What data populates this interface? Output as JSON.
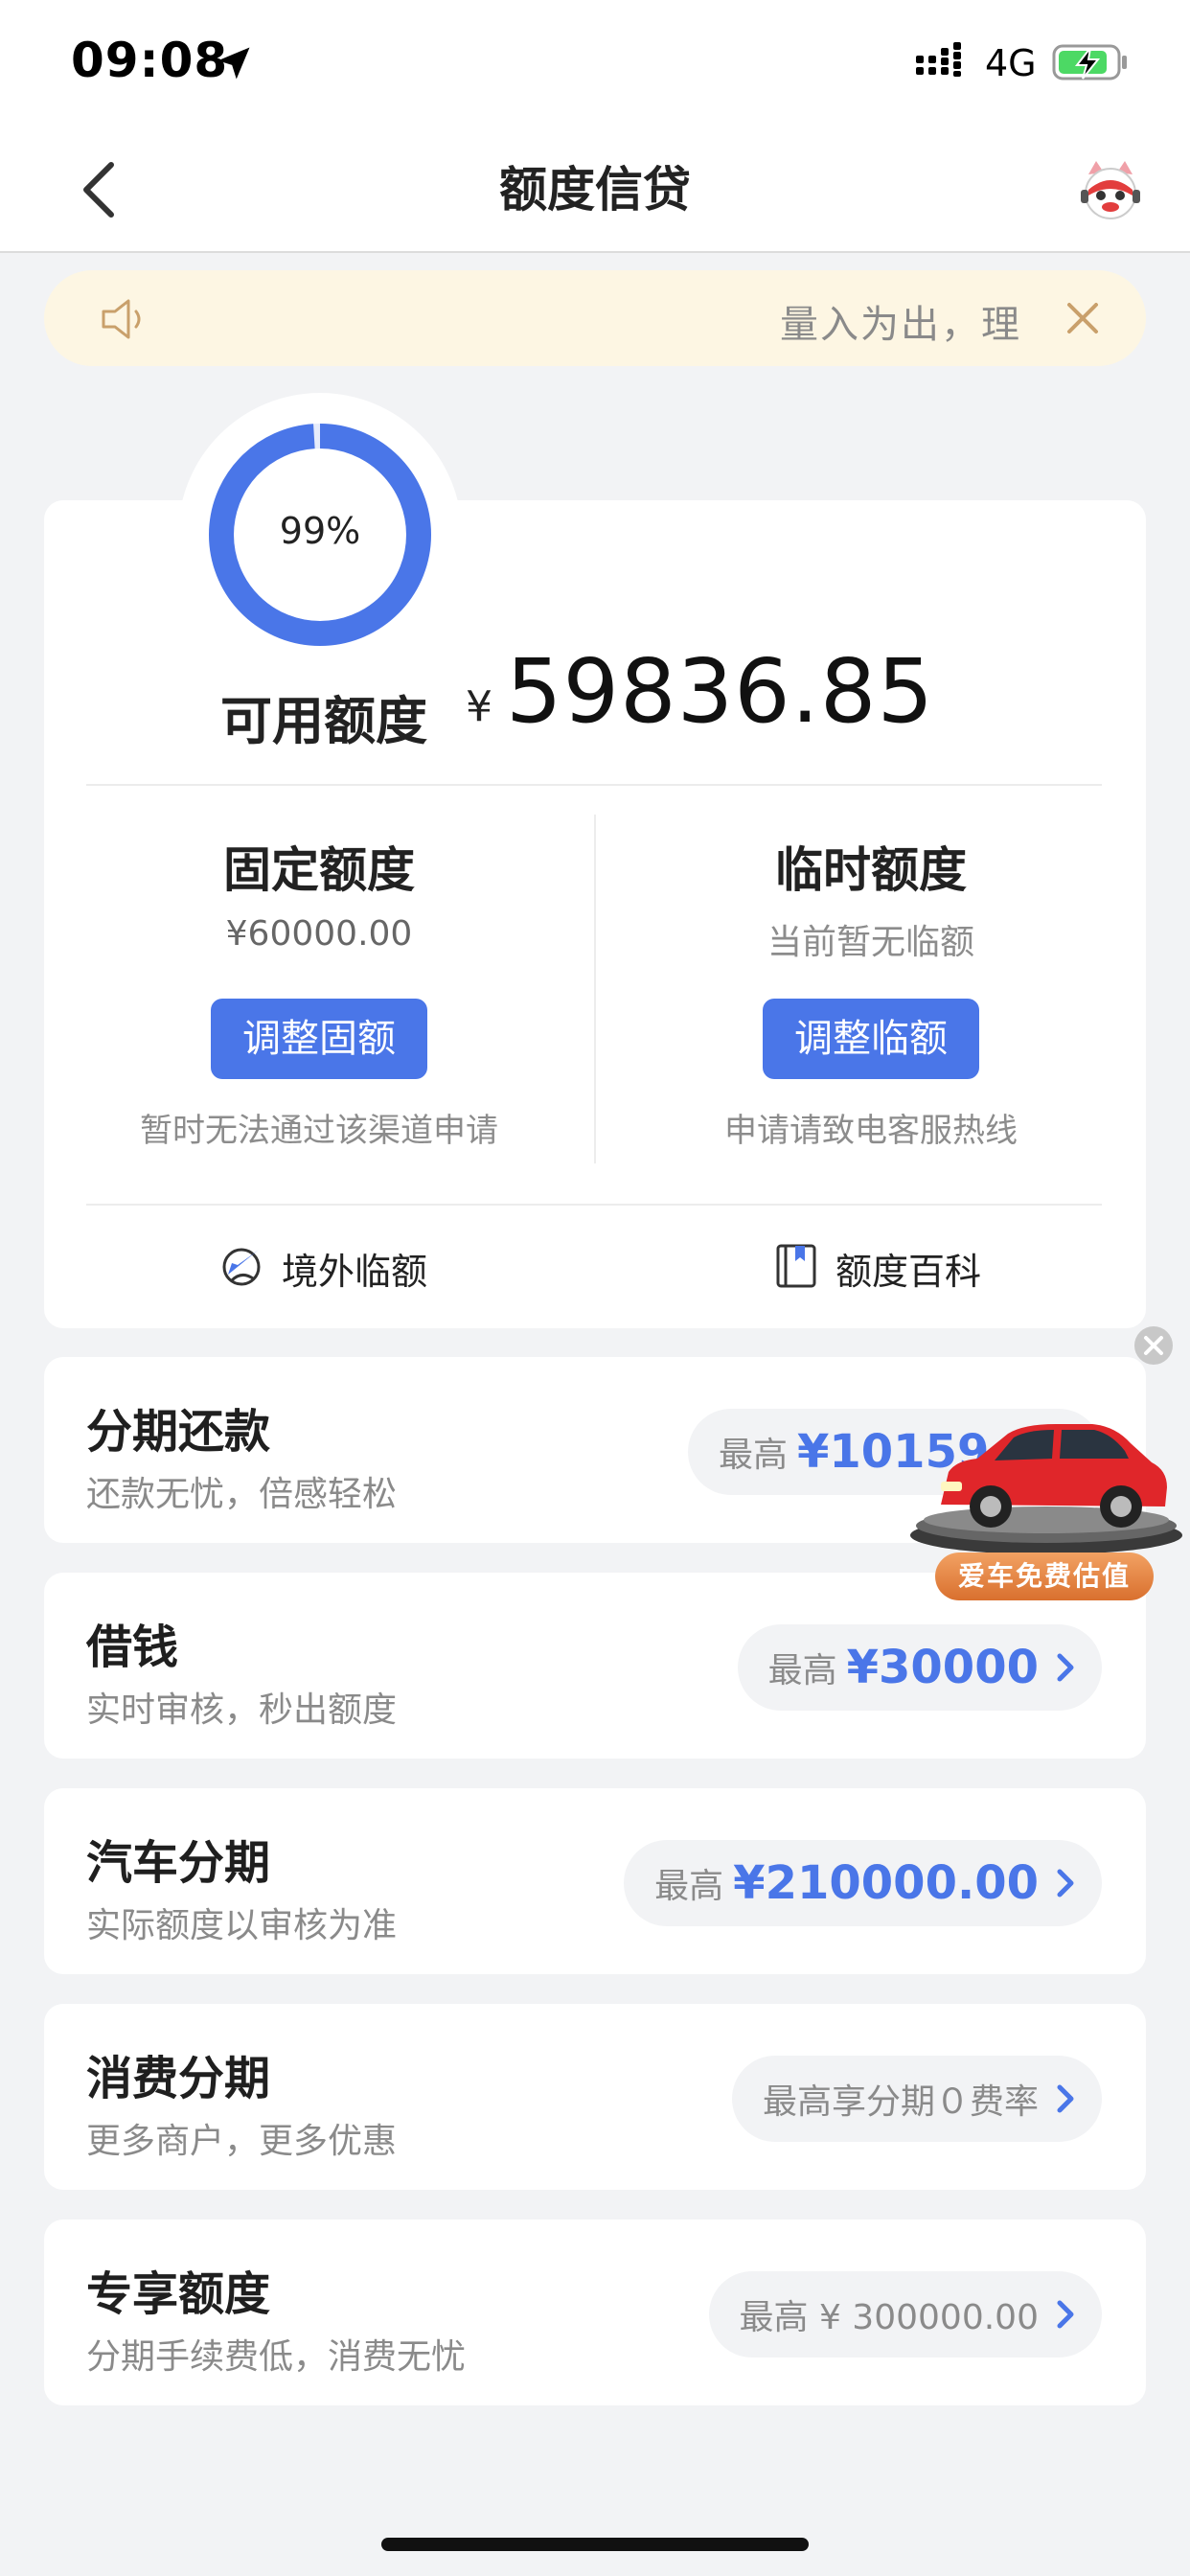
{
  "status_bar": {
    "time": "09:08",
    "network": "4G"
  },
  "nav": {
    "title": "额度信贷"
  },
  "notice": {
    "text": "量入为出，理"
  },
  "credit": {
    "usage_ring": {
      "label": "99%",
      "fraction": 0.99,
      "color": "#4a76e8"
    },
    "available_label": "可用额度",
    "available_currency": "¥",
    "available_amount": "59836.85",
    "fixed": {
      "title": "固定额度",
      "value": "¥60000.00",
      "button": "调整固额",
      "note": "暂时无法通过该渠道申请"
    },
    "temporary": {
      "title": "临时额度",
      "value": "当前暂无临额",
      "button": "调整临额",
      "note": "申请请致电客服热线"
    },
    "links": [
      {
        "label": "境外临额",
        "icon": "globe-plane-icon"
      },
      {
        "label": "额度百科",
        "icon": "book-icon"
      }
    ]
  },
  "products": [
    {
      "title": "分期还款",
      "subtitle": "还款无忧，倍感轻松",
      "pill_prefix": "最高",
      "pill_amount": "¥10159.0"
    },
    {
      "title": "借钱",
      "subtitle": "实时审核，秒出额度",
      "pill_prefix": "最高",
      "pill_amount": "¥30000"
    },
    {
      "title": "汽车分期",
      "subtitle": "实际额度以审核为准",
      "pill_prefix": "最高",
      "pill_amount": "¥210000.00"
    },
    {
      "title": "消费分期",
      "subtitle": "更多商户，更多优惠",
      "pill_prefix": "",
      "pill_amount": "最高享分期０费率"
    },
    {
      "title": "专享额度",
      "subtitle": "分期手续费低，消费无忧",
      "pill_prefix": "",
      "pill_amount": "最高 ¥ 300000.00"
    }
  ],
  "ad": {
    "button": "爱车免费估值"
  },
  "colors": {
    "accent": "#4a76e8",
    "background": "#f2f3f5",
    "notice_bg": "#fdf6e3",
    "notice_icon": "#c9a06b",
    "ad_orange": "#e0843e"
  }
}
